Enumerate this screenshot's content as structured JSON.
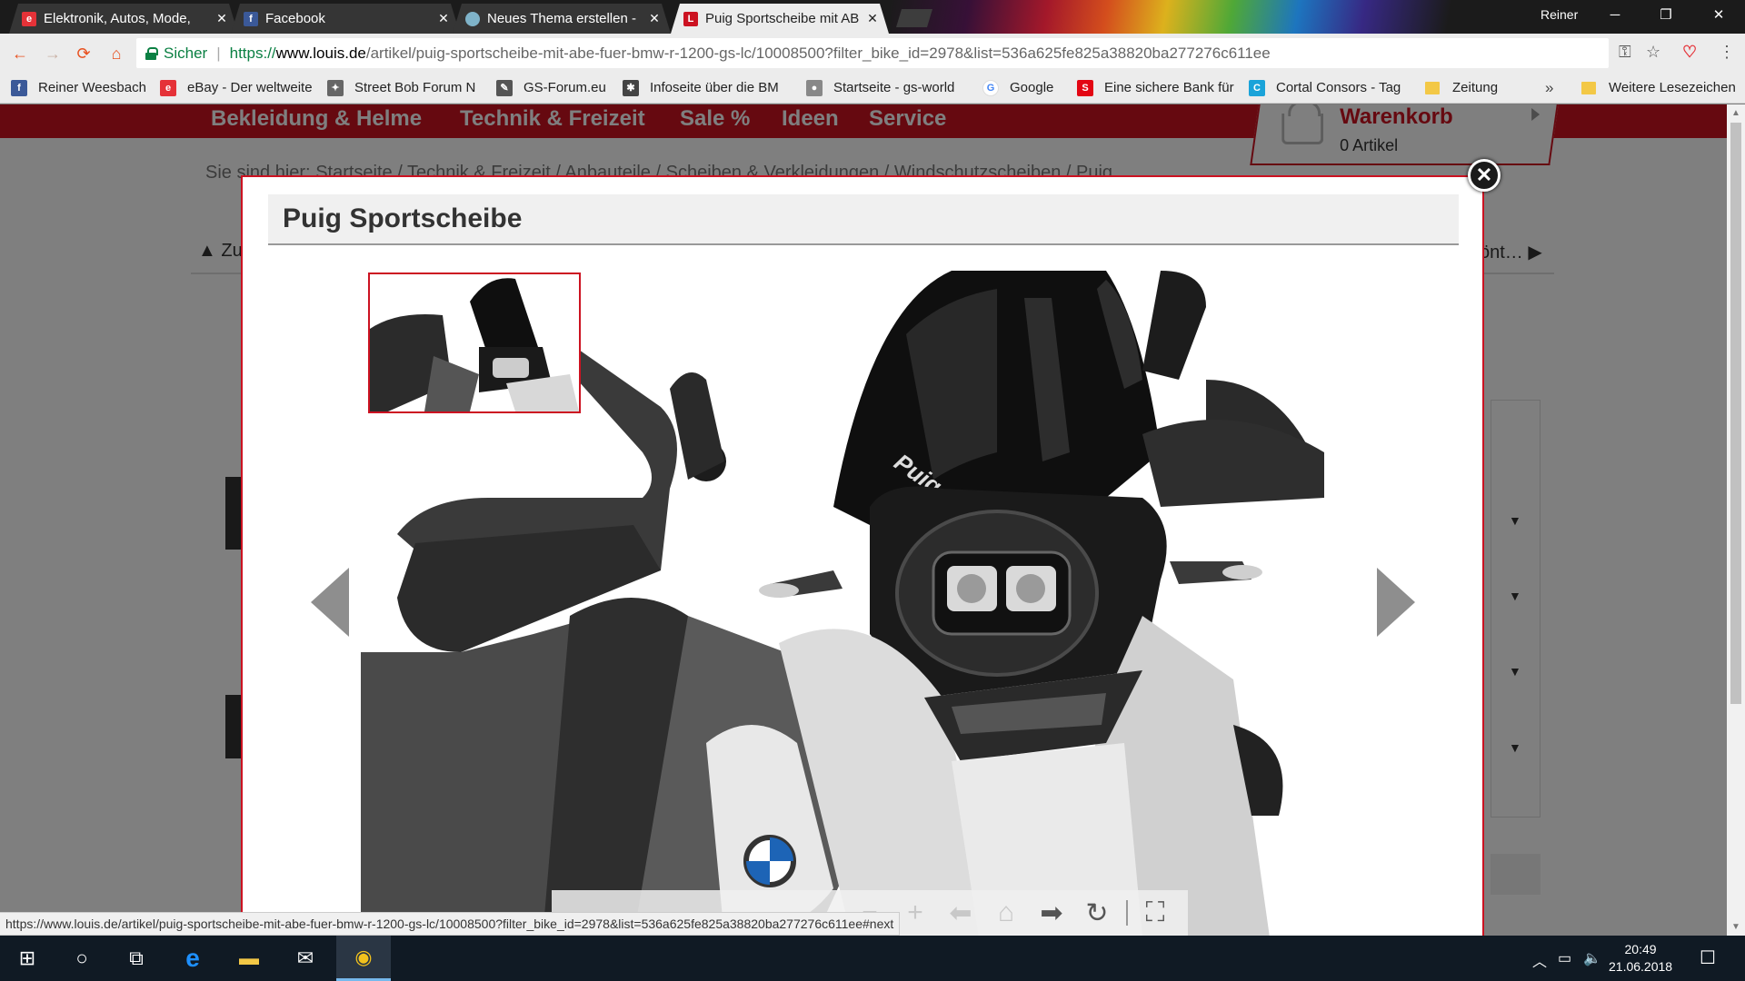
{
  "browser": {
    "tabs": [
      {
        "title": "Elektronik, Autos, Mode,",
        "icon": "ebay-icon",
        "icon_color": "#e53238",
        "active": false
      },
      {
        "title": "Facebook",
        "icon": "facebook-icon",
        "icon_color": "#3b5998",
        "active": false
      },
      {
        "title": "Neues Thema erstellen -",
        "icon": "forum-icon",
        "icon_color": "#7fb3c9",
        "active": false
      },
      {
        "title": "Puig Sportscheibe mit AB",
        "icon": "louis-icon",
        "icon_color": "#cc1221",
        "active": true
      }
    ],
    "tab_close_glyph": "✕",
    "window_user": "Reiner",
    "window_controls": {
      "minimize": "─",
      "restore": "❐",
      "close": "✕"
    },
    "omnibox": {
      "secure_label": "Sicher",
      "url_scheme": "https://",
      "url_domain": "www.louis.de",
      "url_path": "/artikel/puig-sportscheibe-mit-abe-fuer-bmw-r-1200-gs-lc/10008500?filter_bike_id=2978&list=536a625fe825a38820ba277276c611ee"
    },
    "nav_icons": {
      "back": "←",
      "forward": "→",
      "reload": "⟳",
      "home": "⌂"
    },
    "toolbar_icons": {
      "key": "⚿",
      "star": "☆",
      "shield": "♡",
      "menu": "⋮"
    },
    "bookmarks": [
      {
        "label": "Reiner Weesbach",
        "icon": "facebook-icon",
        "color": "#3b5998",
        "glyph": "f"
      },
      {
        "label": "eBay - Der weltweite",
        "icon": "ebay-icon",
        "color": "#e53238",
        "glyph": "e"
      },
      {
        "label": "Street Bob Forum  N",
        "icon": "motorbike-icon",
        "color": "#666666",
        "glyph": "✦"
      },
      {
        "label": "GS-Forum.eu",
        "icon": "gs-forum-icon",
        "color": "#555555",
        "glyph": "✎"
      },
      {
        "label": "Infoseite über die BM",
        "icon": "bmw-info-icon",
        "color": "#444444",
        "glyph": "✱"
      },
      {
        "label": "Startseite - gs-world",
        "icon": "gs-world-icon",
        "color": "#888888",
        "glyph": "●"
      },
      {
        "label": "Google",
        "icon": "google-icon",
        "color": "#4285f4",
        "glyph": "G"
      },
      {
        "label": "Eine sichere Bank für",
        "icon": "bank-icon",
        "color": "#e30613",
        "glyph": "S"
      },
      {
        "label": "Cortal Consors - Tag",
        "icon": "cortal-consors-icon",
        "color": "#1aa3d9",
        "glyph": "C"
      },
      {
        "label": "Zeitung",
        "icon": "folder-icon",
        "color": "#f3c846",
        "glyph": ""
      }
    ],
    "bookmarks_overflow": "»",
    "bookmarks_other": "Weitere Lesezeichen",
    "status_url": "https://www.louis.de/artikel/puig-sportscheibe-mit-abe-fuer-bmw-r-1200-gs-lc/10008500?filter_bike_id=2978&list=536a625fe825a38820ba277276c611ee#next"
  },
  "site": {
    "nav": [
      "Bekleidung & Helme",
      "Technik & Freizeit",
      "Sale %",
      "Ideen",
      "Service"
    ],
    "cart": {
      "title": "Warenkorb",
      "count": "0 Artikel"
    },
    "breadcrumb": {
      "prefix": "Sie sind hier:",
      "items": [
        "Startseite",
        "Technik & Freizeit",
        "Anbauteile",
        "Scheiben & Verkleidungen",
        "Windschutzscheiben",
        "Puig"
      ],
      "separator": " / "
    },
    "prev_link": "Zu",
    "next_link": "önt…",
    "brand_color": "#cc1221"
  },
  "lightbox": {
    "title": "Puig Sportscheibe",
    "close_glyph": "✕",
    "product_mark": "Puig",
    "tools": {
      "next": "➡",
      "reset": "↻",
      "fullscreen": "⛶"
    }
  },
  "taskbar": {
    "start": "⊞",
    "search": "○",
    "task_view": "⧉",
    "apps": [
      {
        "name": "edge-icon",
        "glyph": "e",
        "color": "#1e90ff"
      },
      {
        "name": "explorer-icon",
        "glyph": "▬",
        "color": "#f3c846"
      },
      {
        "name": "mail-icon",
        "glyph": "✉",
        "color": "#ffffff"
      },
      {
        "name": "chrome-icon",
        "glyph": "◉",
        "color": "#f2c21d"
      }
    ],
    "tray": {
      "chevron": "︿",
      "battery": "▭",
      "volume": "🔈",
      "notifications": "☐"
    },
    "time": "20:49",
    "date": "21.06.2018"
  }
}
